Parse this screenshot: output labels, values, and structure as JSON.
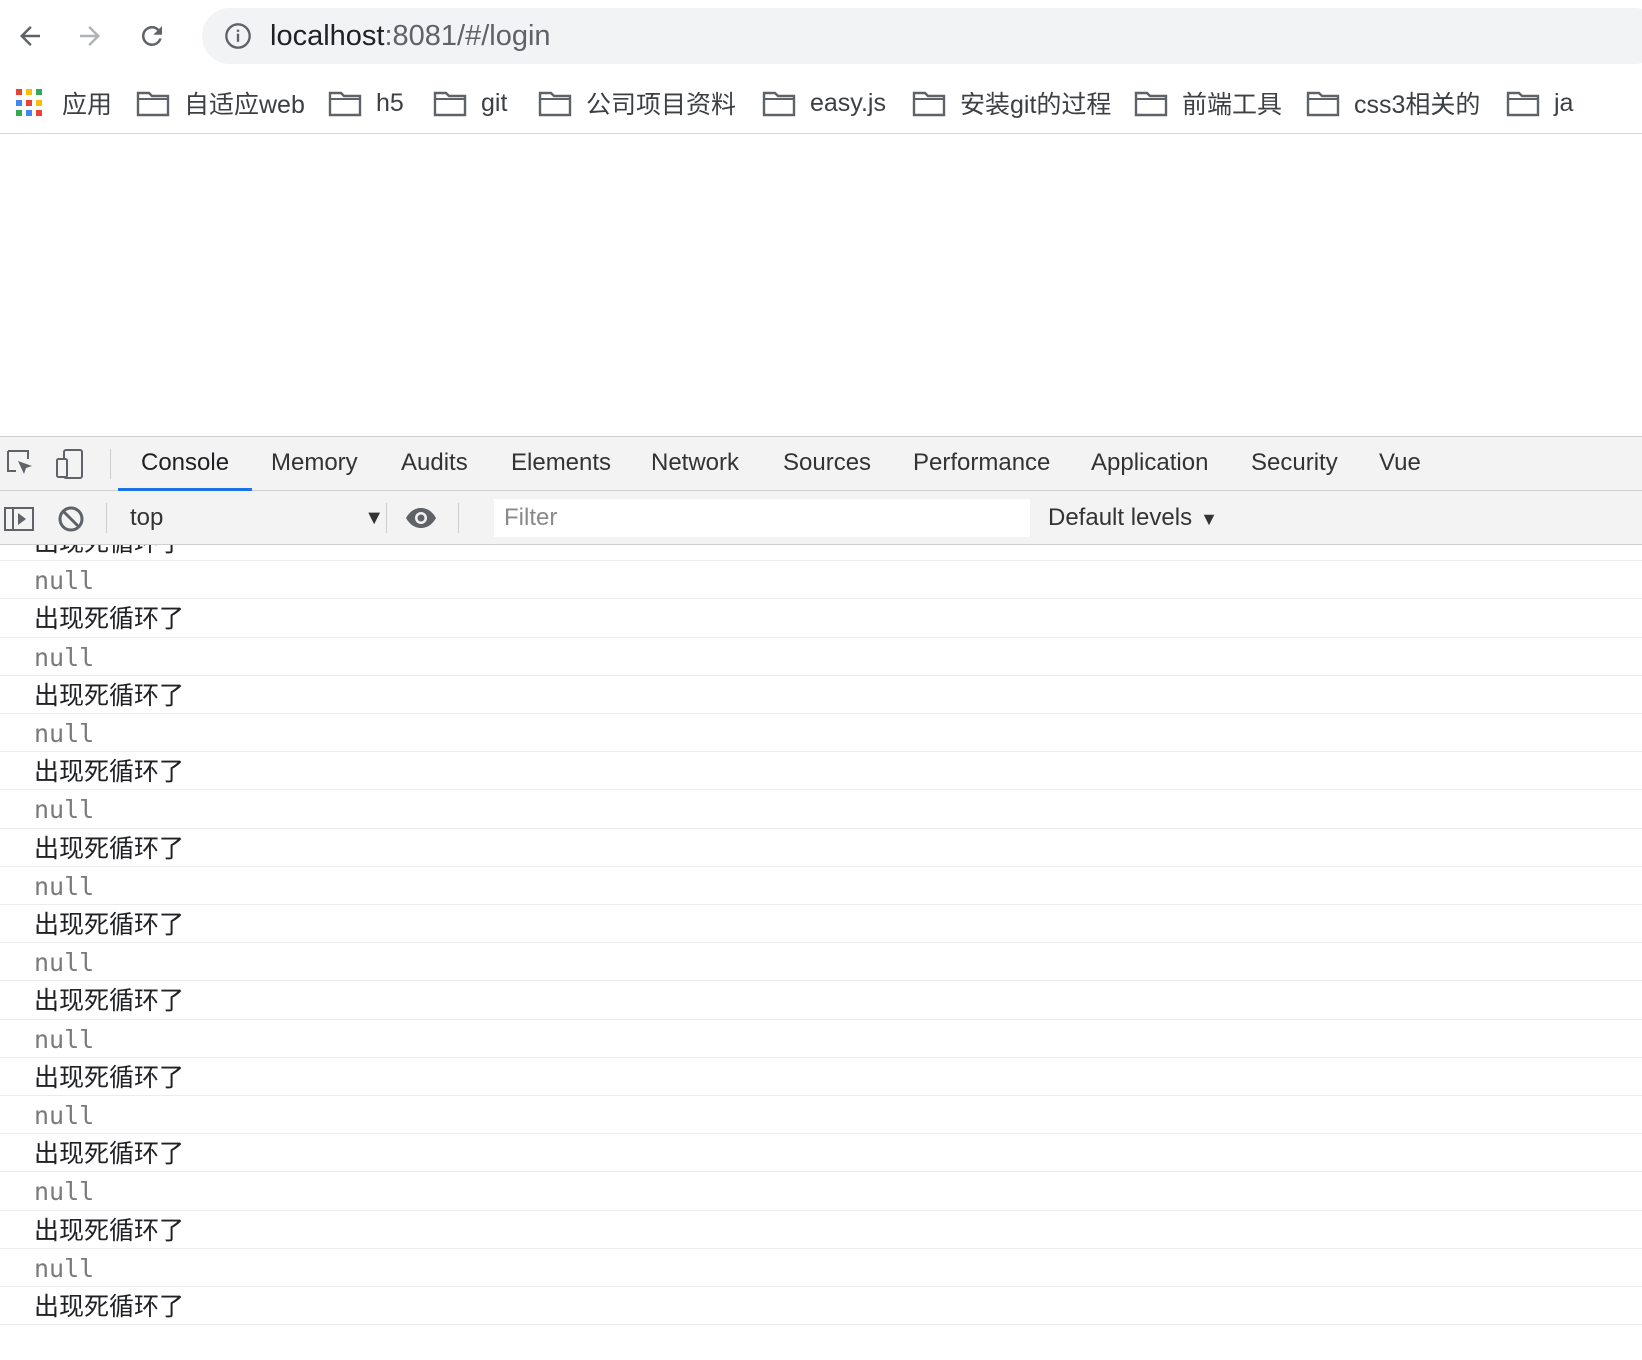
{
  "browser": {
    "url_host": "localhost",
    "url_rest": ":8081/#/login"
  },
  "bookmarks": [
    {
      "label": "应用",
      "icon": "apps-grid-icon"
    },
    {
      "label": "自适应web",
      "icon": "folder-icon"
    },
    {
      "label": "h5",
      "icon": "folder-icon"
    },
    {
      "label": "git",
      "icon": "folder-icon"
    },
    {
      "label": "公司项目资料",
      "icon": "folder-icon"
    },
    {
      "label": "easy.js",
      "icon": "folder-icon"
    },
    {
      "label": "安装git的过程",
      "icon": "folder-icon"
    },
    {
      "label": "前端工具",
      "icon": "folder-icon"
    },
    {
      "label": "css3相关的",
      "icon": "folder-icon"
    },
    {
      "label": "ja",
      "icon": "folder-icon"
    }
  ],
  "devtools": {
    "tabs": [
      "Console",
      "Memory",
      "Audits",
      "Elements",
      "Network",
      "Sources",
      "Performance",
      "Application",
      "Security",
      "Vue"
    ],
    "active_tab": "Console",
    "context": "top",
    "filter_placeholder": "Filter",
    "levels": "Default levels"
  },
  "console_lines": [
    {
      "text": "出现死循环了",
      "kind": "string"
    },
    {
      "text": "null",
      "kind": "null"
    },
    {
      "text": "出现死循环了",
      "kind": "string"
    },
    {
      "text": "null",
      "kind": "null"
    },
    {
      "text": "出现死循环了",
      "kind": "string"
    },
    {
      "text": "null",
      "kind": "null"
    },
    {
      "text": "出现死循环了",
      "kind": "string"
    },
    {
      "text": "null",
      "kind": "null"
    },
    {
      "text": "出现死循环了",
      "kind": "string"
    },
    {
      "text": "null",
      "kind": "null"
    },
    {
      "text": "出现死循环了",
      "kind": "string"
    },
    {
      "text": "null",
      "kind": "null"
    },
    {
      "text": "出现死循环了",
      "kind": "string"
    },
    {
      "text": "null",
      "kind": "null"
    },
    {
      "text": "出现死循环了",
      "kind": "string"
    },
    {
      "text": "null",
      "kind": "null"
    },
    {
      "text": "出现死循环了",
      "kind": "string"
    },
    {
      "text": "null",
      "kind": "null"
    },
    {
      "text": "出现死循环了",
      "kind": "string"
    },
    {
      "text": "null",
      "kind": "null"
    },
    {
      "text": "出现死循环了",
      "kind": "string"
    }
  ],
  "colors": {
    "accent": "#1a73e8",
    "apps": [
      "#ea4335",
      "#fbbc04",
      "#34a853",
      "#4285f4"
    ]
  }
}
